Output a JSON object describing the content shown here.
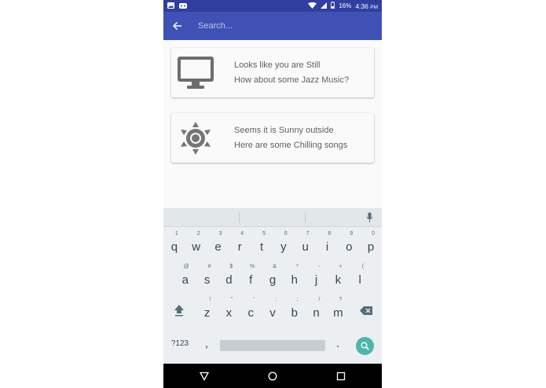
{
  "status_bar": {
    "battery": "16%",
    "time": "4:36",
    "time_suffix": "PM",
    "icons": [
      "image-icon",
      "android-icon",
      "wifi-icon",
      "signal-icon",
      "battery-icon"
    ]
  },
  "app_bar": {
    "back_icon": "arrow-left-icon",
    "search_placeholder": "Search..."
  },
  "cards": [
    {
      "icon": "monitor-icon",
      "line1": "Looks like you are Still",
      "line2": "How about some Jazz Music?"
    },
    {
      "icon": "sun-icon",
      "line1": "Seems it is Sunny outside",
      "line2": "Here are some Chilling songs"
    }
  ],
  "keyboard": {
    "row1": [
      {
        "key": "q",
        "hint": "1"
      },
      {
        "key": "w",
        "hint": "2"
      },
      {
        "key": "e",
        "hint": "3"
      },
      {
        "key": "r",
        "hint": "4"
      },
      {
        "key": "t",
        "hint": "5"
      },
      {
        "key": "y",
        "hint": "6"
      },
      {
        "key": "u",
        "hint": "7"
      },
      {
        "key": "i",
        "hint": "8"
      },
      {
        "key": "o",
        "hint": "9"
      },
      {
        "key": "p",
        "hint": "0"
      }
    ],
    "row2": [
      {
        "key": "a",
        "hint": "@"
      },
      {
        "key": "s",
        "hint": "#"
      },
      {
        "key": "d",
        "hint": "$"
      },
      {
        "key": "f",
        "hint": "%"
      },
      {
        "key": "g",
        "hint": "&"
      },
      {
        "key": "h",
        "hint": "*"
      },
      {
        "key": "j",
        "hint": "-"
      },
      {
        "key": "k",
        "hint": "+"
      },
      {
        "key": "l",
        "hint": "("
      }
    ],
    "row3": [
      {
        "key": "z",
        "hint": "!"
      },
      {
        "key": "x",
        "hint": "\""
      },
      {
        "key": "c",
        "hint": "'"
      },
      {
        "key": "v",
        "hint": ":"
      },
      {
        "key": "b",
        "hint": ";"
      },
      {
        "key": "n",
        "hint": "/"
      },
      {
        "key": "m",
        "hint": "?"
      }
    ],
    "symbols_label": "?123",
    "comma": ",",
    "period": "."
  },
  "nav_bar": {
    "icons": [
      "back-triangle-icon",
      "home-circle-icon",
      "recents-square-icon"
    ]
  }
}
